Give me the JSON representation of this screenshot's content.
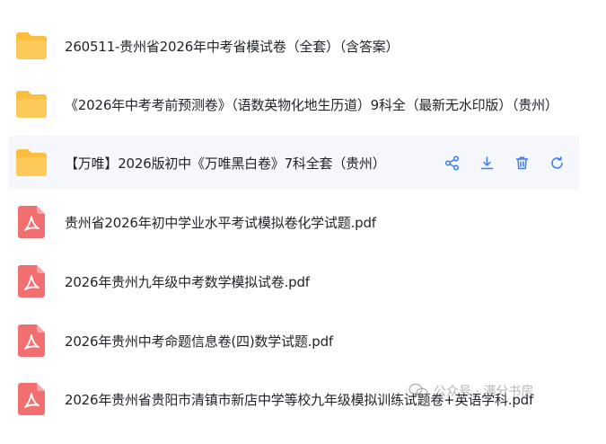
{
  "files": [
    {
      "type": "folder",
      "icon": "folder-icon",
      "name": "260511-贵州省2026年中考省模试卷（全套）（含答案）"
    },
    {
      "type": "folder",
      "icon": "folder-icon",
      "name": "《2026年中考考前预测卷》（语数英物化地生历道）9科全（最新无水印版）（贵州）"
    },
    {
      "type": "folder",
      "icon": "folder-icon",
      "name": "【万唯】2026版初中《万唯黑白卷》7科全套（贵州）",
      "hovered": true
    },
    {
      "type": "pdf",
      "icon": "pdf-icon",
      "name": "贵州省2026年初中学业水平考试模拟卷化学试题.pdf"
    },
    {
      "type": "pdf",
      "icon": "pdf-icon",
      "name": "2026年贵州九年级中考数学模拟试卷.pdf"
    },
    {
      "type": "pdf",
      "icon": "pdf-icon",
      "name": "2026年贵州中考命题信息卷(四)数学试题.pdf"
    },
    {
      "type": "pdf",
      "icon": "pdf-icon",
      "name": "2026年贵州省贵阳市清镇市新店中学等校九年级模拟训练试题卷+英语学科.pdf"
    }
  ],
  "row_actions": {
    "icons": [
      "share-icon",
      "download-icon",
      "delete-icon",
      "refresh-icon"
    ],
    "color": "#3a7bf7"
  },
  "watermark": {
    "text": "公众号 · 满分书房",
    "icon": "wechat-icon"
  },
  "colors": {
    "folder": "#fcc95a",
    "pdf": "#f26f6f",
    "hover_bg": "#f5f7fa",
    "text": "#1f2329"
  }
}
